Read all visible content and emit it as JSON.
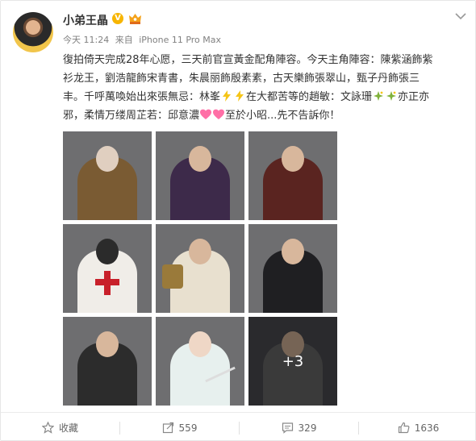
{
  "post": {
    "username": "小弟王晶",
    "verified_badge": "V",
    "time": "今天 11:24",
    "source_prefix": "来自",
    "source_device": "iPhone 11 Pro Max",
    "content_lines": [
      "復拍倚天完成28年心愿，三天前官宣黃金配角陣容。今天主角陣容：陳紫涵飾紫",
      "衫龙王，劉浩龍飾宋青書，朱晨丽飾殷素素，古天樂飾張翠山，甄子丹飾張三",
      "丰。千呼萬喚始出來張無忌：林峯",
      "在大都苦等的趙敏：文詠珊",
      "亦正亦",
      "邪，柔情万缕周芷若：邱意濃",
      "至於小昭...先不告訴你！"
    ],
    "photo_overflow_label": "+3",
    "photo_count_visible": 9
  },
  "actions": {
    "favorite_label": "收藏",
    "repost_count": "559",
    "comment_count": "329",
    "like_count": "1636"
  },
  "icons": {
    "verified": "verified-v-badge-icon",
    "member": "crown-member-icon",
    "dropdown": "chevron-down-icon",
    "lightning": "lightning-emoji-icon",
    "sparkle": "sparkle-emoji-icon",
    "heart": "heart-emoji-icon",
    "favorite": "star-icon",
    "repost": "repost-icon",
    "comment": "comment-icon",
    "like": "thumbs-up-icon"
  },
  "colors": {
    "verified": "#f7b500",
    "lightning": "#f5c518",
    "heart": "#ff6fa6",
    "sparkle": "#7fb13a"
  }
}
